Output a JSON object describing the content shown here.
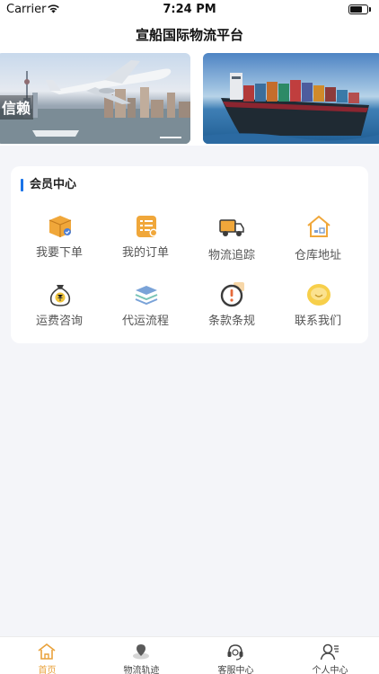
{
  "status_bar": {
    "carrier": "Carrier",
    "time": "7:24 PM"
  },
  "navbar": {
    "title": "宣船国际物流平台"
  },
  "banner": {
    "slides": [
      {
        "text": "信赖"
      },
      {
        "text": ""
      }
    ]
  },
  "member_center": {
    "title": "会员中心",
    "items": [
      {
        "label": "我要下单",
        "icon": "package-icon"
      },
      {
        "label": "我的订单",
        "icon": "order-list-icon"
      },
      {
        "label": "物流追踪",
        "icon": "truck-icon"
      },
      {
        "label": "仓库地址",
        "icon": "warehouse-icon"
      },
      {
        "label": "运费咨询",
        "icon": "money-bag-icon"
      },
      {
        "label": "代运流程",
        "icon": "layers-icon"
      },
      {
        "label": "条款条规",
        "icon": "exclamation-icon"
      },
      {
        "label": "联系我们",
        "icon": "chat-icon"
      }
    ]
  },
  "tabbar": {
    "active_color": "#e9a23b",
    "tabs": [
      {
        "label": "首页",
        "icon": "home-icon",
        "active": true
      },
      {
        "label": "物流轨迹",
        "icon": "location-pin-icon",
        "active": false
      },
      {
        "label": "客服中心",
        "icon": "headset-icon",
        "active": false
      },
      {
        "label": "个人中心",
        "icon": "user-icon",
        "active": false
      }
    ]
  },
  "colors": {
    "accent": "#1a73e8",
    "page_background": "#f4f5f9",
    "icon_orange": "#f0a73a"
  }
}
